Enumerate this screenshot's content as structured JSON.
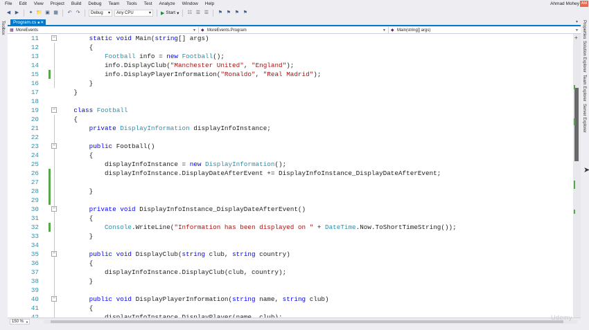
{
  "menu": [
    "File",
    "Edit",
    "View",
    "Project",
    "Build",
    "Debug",
    "Team",
    "Tools",
    "Test",
    "Analyze",
    "Window",
    "Help"
  ],
  "user": {
    "name": "Ahmad Mohey",
    "avatar_initials": "AM"
  },
  "toolbar": {
    "config": "Debug",
    "platform": "Any CPU",
    "start_label": "Start",
    "icons": [
      "back-icon",
      "forward-icon",
      "new-project-icon",
      "open-icon",
      "save-icon",
      "save-all-icon",
      "undo-icon",
      "redo-icon"
    ]
  },
  "side": {
    "toolbox": "Toolbox",
    "right_panels": [
      "Properties",
      "Solution Explorer",
      "Team Explorer",
      "Server Explorer"
    ]
  },
  "tab": {
    "title": "Program.cs"
  },
  "nav": {
    "project": "MoreEvents",
    "class": "MoreEvents.Program",
    "member": "Main(string[] args)"
  },
  "editor": {
    "lines": [
      {
        "num": "11",
        "changed": false,
        "tokens": [
          [
            "kw",
            "        static void "
          ],
          [
            "",
            "Main("
          ],
          [
            "kw",
            "string"
          ],
          [
            "",
            "[] args)"
          ]
        ]
      },
      {
        "num": "12",
        "changed": false,
        "tokens": [
          [
            "",
            "        {"
          ]
        ]
      },
      {
        "num": "13",
        "changed": false,
        "tokens": [
          [
            "ty",
            "            Football"
          ],
          [
            "",
            " info = "
          ],
          [
            "kw",
            "new "
          ],
          [
            "ty",
            "Football"
          ],
          [
            "",
            "();"
          ]
        ]
      },
      {
        "num": "14",
        "changed": false,
        "tokens": [
          [
            "",
            "            info.DisplayClub("
          ],
          [
            "st",
            "\"Manchester United\""
          ],
          [
            "",
            ", "
          ],
          [
            "st",
            "\"England\""
          ],
          [
            "",
            ");"
          ]
        ]
      },
      {
        "num": "15",
        "changed": true,
        "tokens": [
          [
            "",
            "            info.DisplayPlayerInformation("
          ],
          [
            "st",
            "\"Ronaldo\""
          ],
          [
            "",
            ", "
          ],
          [
            "st",
            "\"Real Madrid\""
          ],
          [
            "",
            ");"
          ]
        ]
      },
      {
        "num": "16",
        "changed": false,
        "tokens": [
          [
            "",
            "        }"
          ]
        ]
      },
      {
        "num": "17",
        "changed": false,
        "tokens": [
          [
            "",
            "    }"
          ]
        ]
      },
      {
        "num": "18",
        "changed": false,
        "tokens": [
          [
            "",
            ""
          ]
        ]
      },
      {
        "num": "19",
        "changed": false,
        "tokens": [
          [
            "kw",
            "    class "
          ],
          [
            "ty",
            "Football"
          ]
        ]
      },
      {
        "num": "20",
        "changed": false,
        "tokens": [
          [
            "",
            "    {"
          ]
        ]
      },
      {
        "num": "21",
        "changed": false,
        "tokens": [
          [
            "kw",
            "        private "
          ],
          [
            "ty",
            "DisplayInformation"
          ],
          [
            "",
            " displayInfoInstance;"
          ]
        ]
      },
      {
        "num": "22",
        "changed": false,
        "tokens": [
          [
            "",
            ""
          ]
        ]
      },
      {
        "num": "23",
        "changed": false,
        "tokens": [
          [
            "kw",
            "        public "
          ],
          [
            "",
            "Football()"
          ]
        ]
      },
      {
        "num": "24",
        "changed": false,
        "tokens": [
          [
            "",
            "        {"
          ]
        ]
      },
      {
        "num": "25",
        "changed": false,
        "tokens": [
          [
            "",
            "            displayInfoInstance = "
          ],
          [
            "kw",
            "new "
          ],
          [
            "ty",
            "DisplayInformation"
          ],
          [
            "",
            "();"
          ]
        ]
      },
      {
        "num": "26",
        "changed": true,
        "tokens": [
          [
            "",
            "            displayInfoInstance.DisplayDateAfterEvent += DisplayInfoInstance_DisplayDateAfterEvent;"
          ]
        ]
      },
      {
        "num": "27",
        "changed": true,
        "tokens": [
          [
            "",
            ""
          ]
        ]
      },
      {
        "num": "28",
        "changed": true,
        "tokens": [
          [
            "",
            "        }"
          ]
        ]
      },
      {
        "num": "29",
        "changed": true,
        "tokens": [
          [
            "",
            ""
          ]
        ]
      },
      {
        "num": "30",
        "changed": false,
        "tokens": [
          [
            "kw",
            "        private void "
          ],
          [
            "",
            "DisplayInfoInstance_DisplayDateAfterEvent()"
          ]
        ]
      },
      {
        "num": "31",
        "changed": false,
        "tokens": [
          [
            "",
            "        {"
          ]
        ]
      },
      {
        "num": "32",
        "changed": true,
        "tokens": [
          [
            "ty",
            "            Console"
          ],
          [
            "",
            ".WriteLine("
          ],
          [
            "st",
            "\"Information has been displayed on \""
          ],
          [
            "",
            " + "
          ],
          [
            "ty",
            "DateTime"
          ],
          [
            "",
            ".Now.ToShortTimeString());"
          ]
        ]
      },
      {
        "num": "33",
        "changed": false,
        "tokens": [
          [
            "",
            "        }"
          ]
        ]
      },
      {
        "num": "34",
        "changed": false,
        "tokens": [
          [
            "",
            ""
          ]
        ]
      },
      {
        "num": "35",
        "changed": false,
        "tokens": [
          [
            "kw",
            "        public void "
          ],
          [
            "",
            "DisplayClub("
          ],
          [
            "kw",
            "string"
          ],
          [
            "",
            " club, "
          ],
          [
            "kw",
            "string"
          ],
          [
            "",
            " country)"
          ]
        ]
      },
      {
        "num": "36",
        "changed": false,
        "tokens": [
          [
            "",
            "        {"
          ]
        ]
      },
      {
        "num": "37",
        "changed": false,
        "tokens": [
          [
            "",
            "            displayInfoInstance.DisplayClub(club, country);"
          ]
        ]
      },
      {
        "num": "38",
        "changed": false,
        "tokens": [
          [
            "",
            "        }"
          ]
        ]
      },
      {
        "num": "39",
        "changed": false,
        "tokens": [
          [
            "",
            ""
          ]
        ]
      },
      {
        "num": "40",
        "changed": false,
        "tokens": [
          [
            "kw",
            "        public void "
          ],
          [
            "",
            "DisplayPlayerInformation("
          ],
          [
            "kw",
            "string"
          ],
          [
            "",
            " name, "
          ],
          [
            "kw",
            "string"
          ],
          [
            "",
            " club)"
          ]
        ]
      },
      {
        "num": "41",
        "changed": false,
        "tokens": [
          [
            "",
            "        {"
          ]
        ]
      },
      {
        "num": "42",
        "changed": false,
        "tokens": [
          [
            "",
            "            displayInfoInstance.DisplayPlayer(name, club);"
          ]
        ]
      }
    ]
  },
  "zoom": "150 %",
  "colors": {
    "accent": "#007acc",
    "keyword": "#0000ff",
    "type": "#2b91af",
    "string": "#a31515",
    "change": "#57a64a"
  },
  "watermark": "Udemy"
}
